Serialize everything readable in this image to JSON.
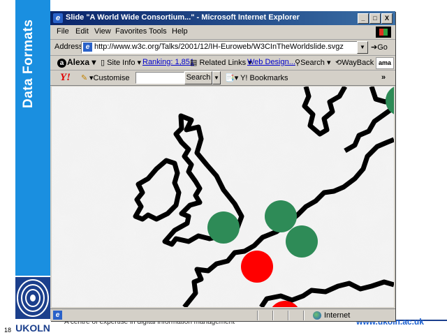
{
  "slide": {
    "vertical_title": "Data Formats",
    "slide_number": "18",
    "logo_text": "UKOLN",
    "footer_left": "A centre of expertise in digital information management",
    "footer_right": "www.ukoln.ac.uk"
  },
  "browser": {
    "title": "Slide \"A World Wide Consortium...\" - Microsoft Internet Explorer",
    "window_buttons": [
      "_",
      "□",
      "X"
    ],
    "menu": [
      "File",
      "Edit",
      "View",
      "Favorites",
      "Tools",
      "Help"
    ],
    "address_label": "Address",
    "url": "http://www.w3c.org/Talks/2001/12/IH-Euroweb/W3CInTheWorldslide.svgz",
    "go_label": "Go",
    "alexa": {
      "logo": "Alexa",
      "site_info": "Site Info",
      "ranking": "Ranking: 1,851",
      "related_links": "Related Links",
      "web_design": "Web Design...",
      "search": "Search",
      "wayback": "WayBack",
      "amazon": "ama"
    },
    "yahoo": {
      "logo": "Y!",
      "customise": "Customise",
      "search_input_value": "",
      "search_button": "Search",
      "bookmarks": "Y! Bookmarks",
      "more": "»"
    },
    "status": {
      "zone": "Internet"
    }
  },
  "map": {
    "colors": {
      "land_outline": "#000000",
      "background": "#f2f2f2",
      "member_green": "#2e8b57",
      "member_red": "#ff0000"
    }
  }
}
